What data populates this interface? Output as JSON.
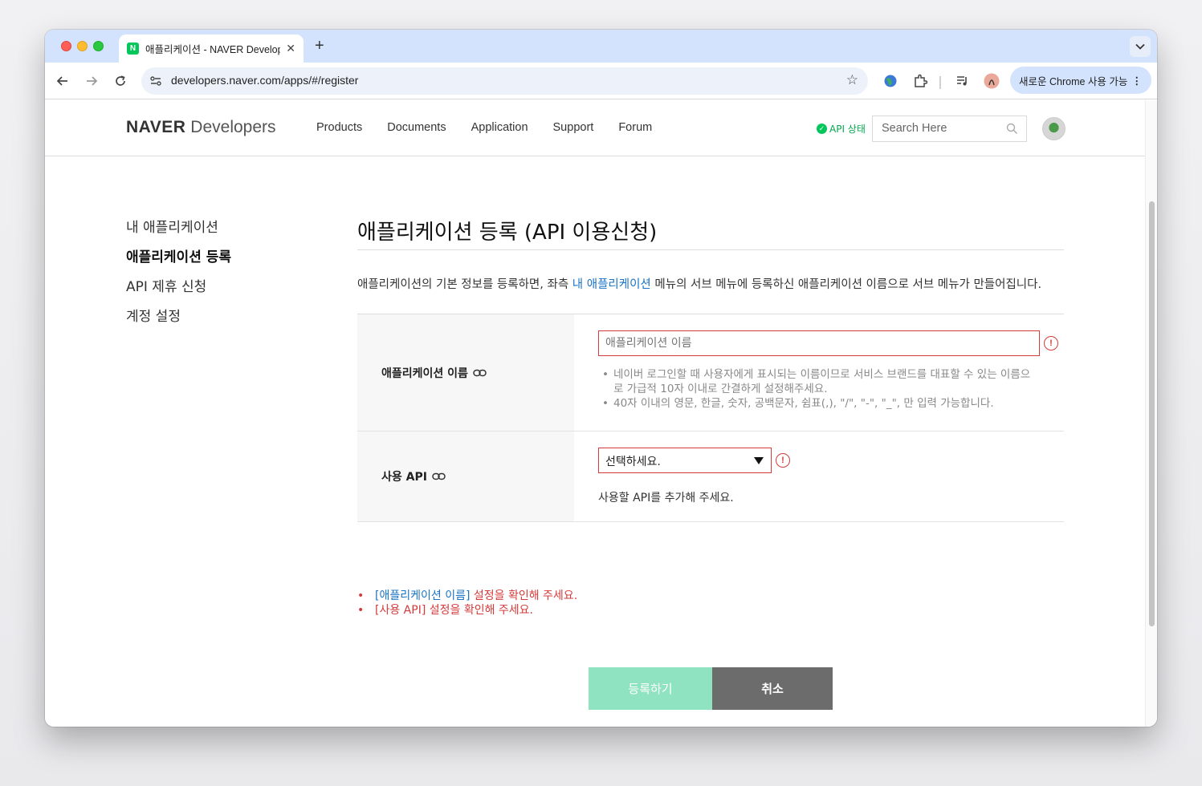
{
  "browser": {
    "tab_title": "애플리케이션 - NAVER Developers",
    "tab_favicon_letter": "N",
    "url": "developers.naver.com/apps/#/register",
    "new_tab_symbol": "+",
    "close_tab_symbol": "✕",
    "chrome_button_label": "새로운 Chrome 사용 가능",
    "chrome_button_menu": "⋮"
  },
  "header": {
    "logo_bold": "NAVER",
    "logo_light": "Developers",
    "nav": [
      "Products",
      "Documents",
      "Application",
      "Support",
      "Forum"
    ],
    "api_status": "API 상태",
    "search_placeholder": "Search Here"
  },
  "sidebar": {
    "items": [
      {
        "label": "내 애플리케이션",
        "active": false
      },
      {
        "label": "애플리케이션 등록",
        "active": true
      },
      {
        "label": "API 제휴 신청",
        "active": false
      },
      {
        "label": "계정 설정",
        "active": false
      }
    ]
  },
  "main": {
    "title": "애플리케이션 등록 (API 이용신청)",
    "desc_before": "애플리케이션의 기본 정보를 등록하면, 좌측 ",
    "desc_link": "내 애플리케이션",
    "desc_after": " 메뉴의 서브 메뉴에 등록하신 애플리케이션 이름으로 서브 메뉴가 만들어집니다.",
    "app_name": {
      "label": "애플리케이션 이름",
      "placeholder": "애플리케이션 이름",
      "value": "",
      "hints": [
        "네이버 로그인할 때 사용자에게 표시되는 이름이므로 서비스 브랜드를 대표할 수 있는 이름으로 가급적 10자 이내로 간결하게 설정해주세요.",
        "40자 이내의 영문, 한글, 숫자, 공백문자, 쉼표(,), \"/\", \"-\", \"_\", 만 입력 가능합니다."
      ]
    },
    "api": {
      "label": "사용 API",
      "selected": "선택하세요.",
      "hint": "사용할 API를 추가해 주세요."
    },
    "error_icon": "!"
  },
  "errors": {
    "line1_link": "[애플리케이션 이름]",
    "line1_text": " 설정을 확인해 주세요.",
    "line2_text": "[사용 API] 설정을 확인해 주세요."
  },
  "buttons": {
    "register": "등록하기",
    "cancel": "취소"
  },
  "colors": {
    "error": "#d33b3b",
    "link": "#1a73c6",
    "register_bg": "#8fe3c0",
    "cancel_bg": "#6c6c6c",
    "naver_green": "#03c75a"
  }
}
